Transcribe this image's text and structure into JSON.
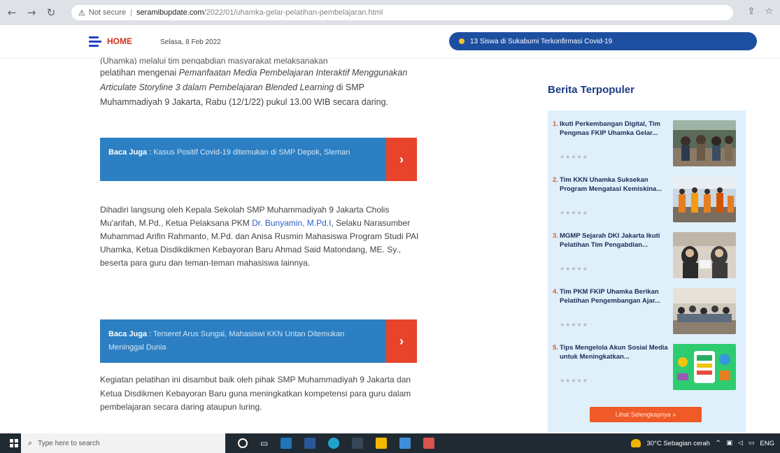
{
  "browser": {
    "not_secure": "Not secure",
    "host": "seramibupdate.com",
    "path": "/2022/01/uhamka-gelar-pelatihan-pembelajaran.html"
  },
  "site": {
    "home_label": "HOME",
    "date": "Selasa, 8 Feb 2022",
    "ticker": "13 Siswa di Sukabumi Terkonfirmasi Covid-19"
  },
  "article": {
    "cut_line": "(Uhamka) melalui tim pengabdian masyarakat melaksanakan",
    "p1_a": "pelatihan mengenai ",
    "p1_em": "Pemanfaatan Media Pembelajaran Interaktif Menggunakan Articulate Storyline 3 dalam Pembelajaran Blended Learning",
    "p1_b": " di SMP Muhammadiyah 9 Jakarta, Rabu (12/1/22) pukul 13.00 WIB secara daring.",
    "baca1_label": "Baca Juga",
    "baca1_sep": " : ",
    "baca1_text": "Kasus Positif Covid-19 ditemukan di SMP Depok, Sleman",
    "p2_a": "Dihadiri langsung oleh Kepala Sekolah SMP Muhammadiyah 9 Jakarta Cholis Mu'arifah, M.Pd., Ketua Pelaksana PKM ",
    "p2_link": "Dr. Bunyamin, M.Pd.I",
    "p2_b": ", Selaku Narasumber Muhammad Arifin Rahmanto, M.Pd. dan Anisa Rusmin Mahasiswa Program Studi PAI Uhamka, Ketua Disdikdikmen Kebayoran Baru Ahmad Said Matondang, ME. Sy., beserta para guru dan teman-teman mahasiswa lainnya.",
    "baca2_label": "Baca Juga",
    "baca2_sep": " : ",
    "baca2_text": "Terseret Arus Sungai, Mahasiswi KKN Untan Ditemukan Meninggal Dunia",
    "p3": "Kegiatan pelatihan ini disambut baik oleh pihak SMP Muhammadiyah 9 Jakarta dan Ketua Disdikmen Kebayoran Baru guna meningkatkan kompetensi para guru dalam pembelajaran secara daring ataupun luring."
  },
  "sidebar": {
    "title": "Berita Terpopuler",
    "stars": "★★★★★",
    "items": [
      {
        "num": "1.",
        "title": "Ikuti Perkembangan Digital, Tim Pengmas FKIP Uhamka Gelar..."
      },
      {
        "num": "2.",
        "title": "Tim KKN Uhamka Suksekan Program Mengatasi Kemiskina..."
      },
      {
        "num": "3.",
        "title": "MGMP Sejarah DKI Jakarta Ikuti Pelatihan Tim Pengabdian..."
      },
      {
        "num": "4.",
        "title": "Tim PKM FKIP Uhamka Berikan Pelatihan Pengembangan Ajar..."
      },
      {
        "num": "5.",
        "title": "Tips Mengelola Akun Sosial Media untuk Meningkatkan..."
      }
    ],
    "more_button": "Lihat Selengkapnya »"
  },
  "taskbar": {
    "search_placeholder": "Type here to search",
    "weather": "30°C Sebagian cerah",
    "lang": "ENG"
  },
  "colors": {
    "accent_blue": "#2c7fc2",
    "accent_red": "#e8432b",
    "sidebar_bg": "#dff0fb",
    "title_navy": "#1b3c87"
  }
}
